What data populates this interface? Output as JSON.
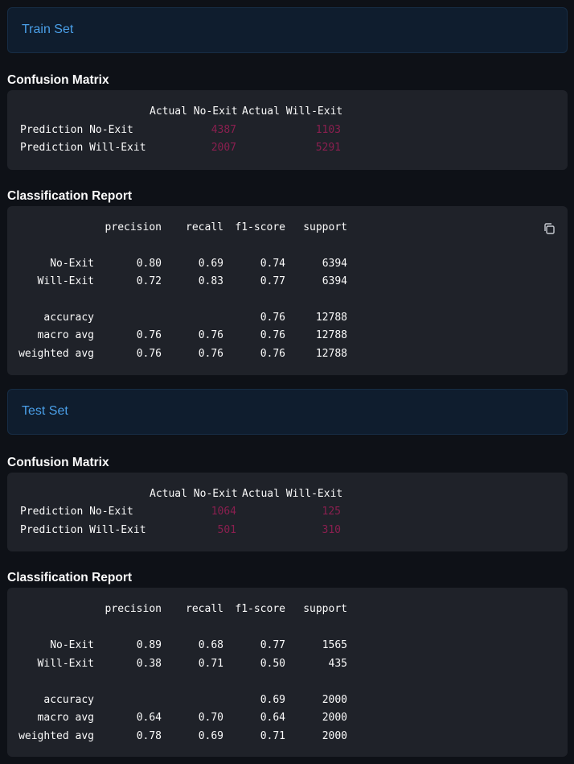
{
  "train": {
    "banner": "Train Set",
    "cm_heading": "Confusion Matrix",
    "cm": {
      "col1": "Actual No-Exit",
      "col2": "Actual Will-Exit",
      "rows": [
        {
          "label": "Prediction No-Exit",
          "v1": "4387",
          "v2": "1103"
        },
        {
          "label": "Prediction Will-Exit",
          "v1": "2007",
          "v2": "5291"
        }
      ]
    },
    "cr_heading": "Classification Report",
    "cr": {
      "headers": [
        "precision",
        "recall",
        "f1-score",
        "support"
      ],
      "rows": [
        {
          "label": "No-Exit",
          "p": "0.80",
          "r": "0.69",
          "f": "0.74",
          "s": "6394"
        },
        {
          "label": "Will-Exit",
          "p": "0.72",
          "r": "0.83",
          "f": "0.77",
          "s": "6394"
        },
        {
          "label": "accuracy",
          "p": "",
          "r": "",
          "f": "0.76",
          "s": "12788"
        },
        {
          "label": "macro avg",
          "p": "0.76",
          "r": "0.76",
          "f": "0.76",
          "s": "12788"
        },
        {
          "label": "weighted avg",
          "p": "0.76",
          "r": "0.76",
          "f": "0.76",
          "s": "12788"
        }
      ]
    }
  },
  "test": {
    "banner": "Test Set",
    "cm_heading": "Confusion Matrix",
    "cm": {
      "col1": "Actual No-Exit",
      "col2": "Actual Will-Exit",
      "rows": [
        {
          "label": "Prediction No-Exit",
          "v1": "1064",
          "v2": "125"
        },
        {
          "label": "Prediction Will-Exit",
          "v1": "501",
          "v2": "310"
        }
      ]
    },
    "cr_heading": "Classification Report",
    "cr": {
      "headers": [
        "precision",
        "recall",
        "f1-score",
        "support"
      ],
      "rows": [
        {
          "label": "No-Exit",
          "p": "0.89",
          "r": "0.68",
          "f": "0.77",
          "s": "1565"
        },
        {
          "label": "Will-Exit",
          "p": "0.38",
          "r": "0.71",
          "f": "0.50",
          "s": "435"
        },
        {
          "label": "accuracy",
          "p": "",
          "r": "",
          "f": "0.69",
          "s": "2000"
        },
        {
          "label": "macro avg",
          "p": "0.64",
          "r": "0.70",
          "f": "0.64",
          "s": "2000"
        },
        {
          "label": "weighted avg",
          "p": "0.78",
          "r": "0.69",
          "f": "0.71",
          "s": "2000"
        }
      ]
    }
  },
  "colors": {
    "banner_text": "#4a9fe8",
    "matrix_values": "#8a1f4f",
    "code_bg": "#1f2229"
  },
  "icons": {
    "copy": "copy-icon"
  }
}
